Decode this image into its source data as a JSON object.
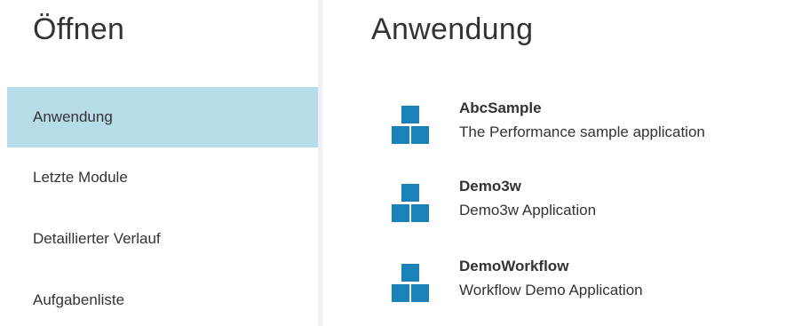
{
  "nav": {
    "title": "Öffnen",
    "items": [
      {
        "label": "Anwendung",
        "active": true
      },
      {
        "label": "Letzte Module",
        "active": false
      },
      {
        "label": "Detaillierter Verlauf",
        "active": false
      },
      {
        "label": "Aufgabenliste",
        "active": false
      }
    ]
  },
  "main": {
    "title": "Anwendung",
    "apps": [
      {
        "name": "AbcSample",
        "description": "The Performance sample application",
        "icon": "application-blocks-icon"
      },
      {
        "name": "Demo3w",
        "description": "Demo3w Application",
        "icon": "application-blocks-icon"
      },
      {
        "name": "DemoWorkflow",
        "description": "Workflow Demo Application",
        "icon": "application-blocks-icon"
      }
    ]
  },
  "colors": {
    "active_background": "#b6dcea",
    "icon_blue": "#1a82b8",
    "text": "#333333",
    "divider": "#f0f0f0"
  }
}
